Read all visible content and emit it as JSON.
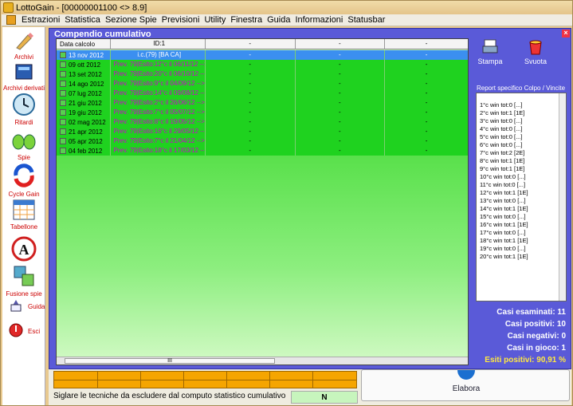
{
  "window": {
    "title": "LottoGain - [00000001100  <>  8.9]"
  },
  "menu": [
    "Estrazioni",
    "Statistica",
    "Sezione Spie",
    "Previsioni",
    "Utility",
    "Finestra",
    "Guida",
    "Informazioni",
    "Statusbar"
  ],
  "sidebar": [
    {
      "label": "Archivi",
      "icon": "pencil-icon"
    },
    {
      "label": "Archivi derivati",
      "icon": "book-icon"
    },
    {
      "label": "Ritardi",
      "icon": "clock-icon"
    },
    {
      "label": "Spie",
      "icon": "binoculars-icon"
    },
    {
      "label": "Cycle Gain",
      "icon": "cycle-icon"
    },
    {
      "label": "Tabellone",
      "icon": "table-icon"
    },
    {
      "label": "",
      "icon": "letter-a-icon"
    },
    {
      "label": "Fusione spie",
      "icon": "fusion-icon"
    },
    {
      "label": "Guida",
      "icon": "help-book-icon"
    },
    {
      "label": "Esci",
      "icon": "exit-icon"
    }
  ],
  "panel": {
    "title": "Compendio cumulativo",
    "columns": [
      "Data calcolo",
      "ID:1",
      "-",
      "-",
      "-"
    ],
    "rows": [
      {
        "date": "13 nov 2012",
        "id": "i.c.(79) [BA CA]",
        "c2": "-",
        "c3": "-",
        "c4": "-",
        "selected": true
      },
      {
        "date": "09 ott 2012",
        "id": "Prev. 79|Esito:12°c il 06/11/12 -->",
        "c2": "-",
        "c3": "-",
        "c4": "-"
      },
      {
        "date": "13 set 2012",
        "id": "Prev. 79|Esito:20°c il 06/10/12 -->",
        "c2": "-",
        "c3": "-",
        "c4": "-"
      },
      {
        "date": "14 ago 2012",
        "id": "Prev. 79|Esito:9°c il 04/09/12 -->",
        "c2": "-",
        "c3": "-",
        "c4": "-"
      },
      {
        "date": "07 lug 2012",
        "id": "Prev. 79|Esito:14°c il 09/08/12 -->",
        "c2": "-",
        "c3": "-",
        "c4": "-"
      },
      {
        "date": "21 giu 2012",
        "id": "Prev. 79|Esito:2°c il 26/06/12 -->",
        "c2": "-",
        "c3": "-",
        "c4": "-"
      },
      {
        "date": "19 giu 2012",
        "id": "Prev. 79|Esito:7°c il 05/07/12 -->",
        "c2": "-",
        "c3": "-",
        "c4": "-"
      },
      {
        "date": "02 mag 2012",
        "id": "Prev. 79|Esito:8°c il 19/05/12 -->",
        "c2": "-",
        "c3": "-",
        "c4": "-"
      },
      {
        "date": "21 apr 2012",
        "id": "Prev. 79|Esito:16°c il 29/05/12 -->",
        "c2": "-",
        "c3": "-",
        "c4": "-"
      },
      {
        "date": "05 apr 2012",
        "id": "Prev. 79|Esito:7°c il 21/04/12 -->",
        "c2": "-",
        "c3": "-",
        "c4": "-"
      },
      {
        "date": "04 feb 2012",
        "id": "Prev. 79|Esito:18°c il 17/03/12 -->",
        "c2": "-",
        "c3": "-",
        "c4": "-"
      }
    ],
    "scroll_label": "III"
  },
  "side": {
    "print_label": "Stampa",
    "empty_label": "Svuota",
    "report_title": "Report specifico Colpo / Vincite",
    "report_items": [
      "1°c win tot:0 [...]",
      "2°c win tot:1 [1E]",
      "3°c win tot:0 [...]",
      "4°c win tot:0 [...]",
      "5°c win tot:0 [...]",
      "6°c win tot:0 [...]",
      "7°c win tot:2 [2E]",
      "8°c win tot:1 [1E]",
      "9°c win tot:1 [1E]",
      "10°c win tot:0 [...]",
      "11°c win tot:0 [...]",
      "12°c win tot:1 [1E]",
      "13°c win tot:0 [...]",
      "14°c win tot:1 [1E]",
      "15°c win tot:0 [...]",
      "16°c win tot:1 [1E]",
      "17°c win tot:0 [...]",
      "18°c win tot:1 [1E]",
      "19°c win tot:0 [...]",
      "20°c win tot:1 [1E]"
    ],
    "stats": {
      "examined": "Casi esaminati: 11",
      "positive": "Casi positivi: 10",
      "negative": "Casi negativi: 0",
      "in_play": "Casi in gioco: 1",
      "outcome": "Esiti positivi: 90,91 %"
    }
  },
  "bottom": {
    "note": "Siglare le tecniche da escludere dal computo statistico cumulativo",
    "n_value": "N",
    "elabora_label": "Elabora"
  }
}
